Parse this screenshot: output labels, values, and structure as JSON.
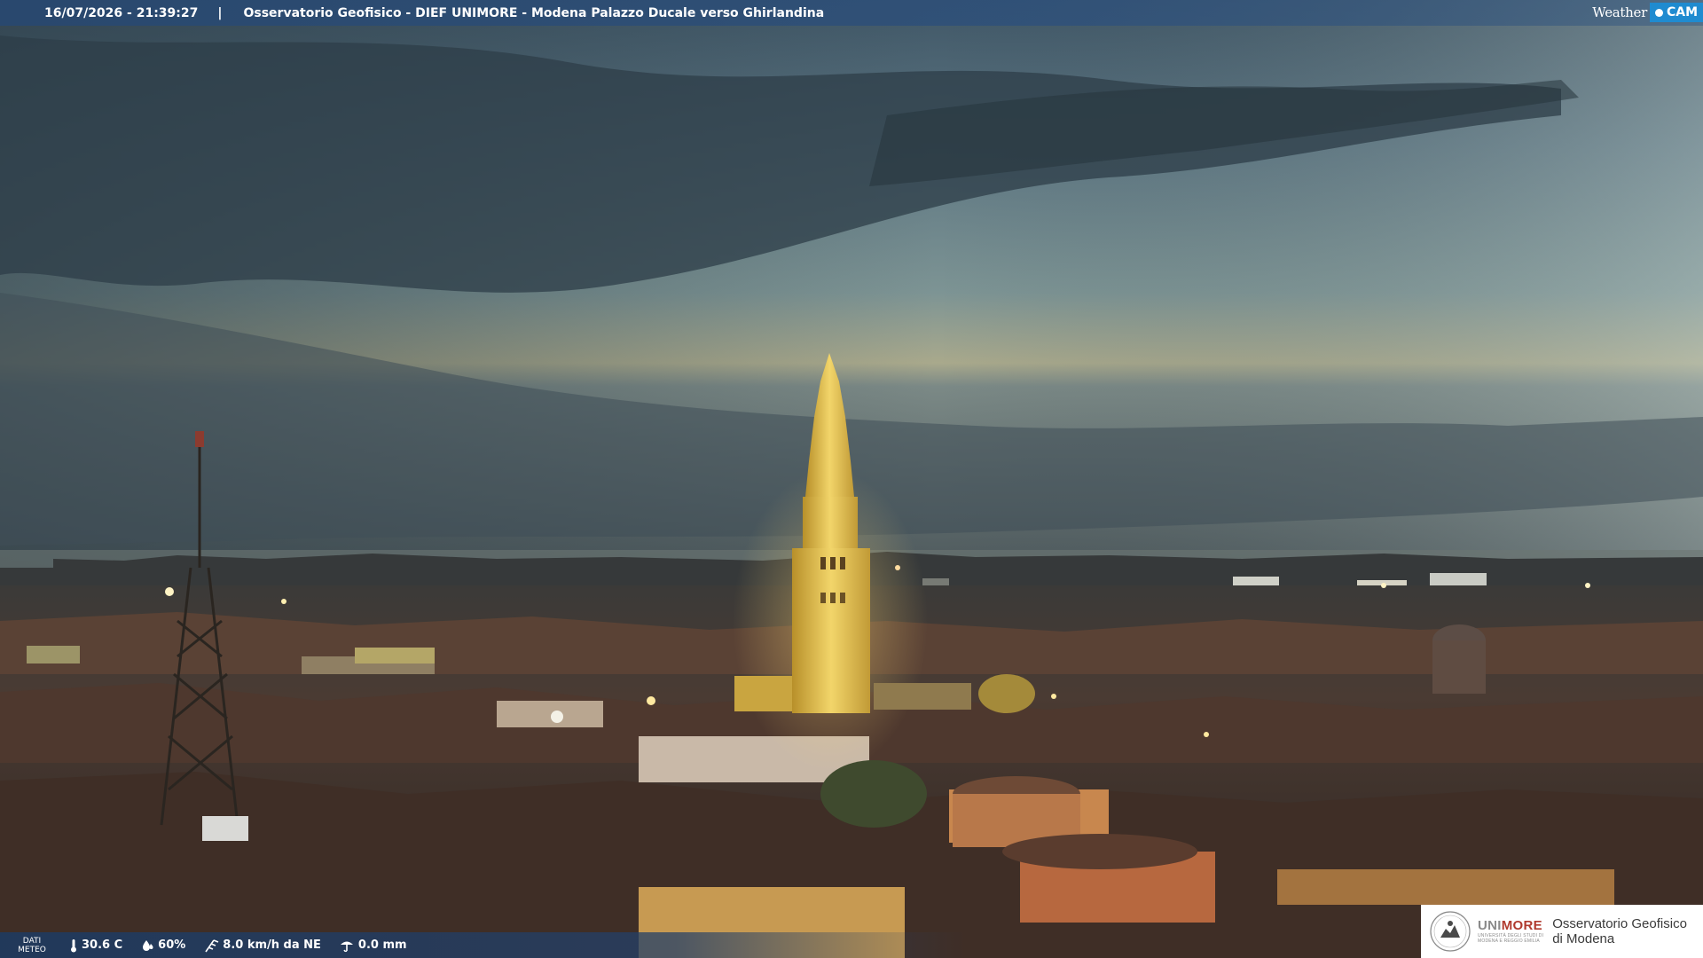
{
  "overlay": {
    "timestamp": "16/07/2026 - 21:39:27",
    "separator": "|",
    "caption": "Osservatorio Geofisico - DIEF UNIMORE - Modena Palazzo Ducale verso Ghirlandina"
  },
  "badge": {
    "weather": "Weather",
    "cam": "CAM"
  },
  "meteo": {
    "label_line1": "DATI",
    "label_line2": "METEO",
    "temperature": "30.6 C",
    "humidity": "60%",
    "wind": "8.0 km/h da NE",
    "rain": "0.0 mm",
    "icons": [
      "thermometer-icon",
      "humidity-drop-icon",
      "wind-icon",
      "rain-gauge-icon"
    ]
  },
  "logo": {
    "uni_part1": "UNI",
    "uni_part2": "MORE",
    "uni_sub1": "UNIVERSITÀ DEGLI STUDI DI",
    "uni_sub2": "MODENA E REGGIO EMILIA",
    "obs_line1": "Osservatorio Geofisico",
    "obs_line2": "di Modena"
  },
  "colors": {
    "bar": "#2c4e78",
    "badge_blue": "#1f8bd0",
    "tower_glow": "#e8c35a",
    "unimore_red": "#b03a2e"
  }
}
